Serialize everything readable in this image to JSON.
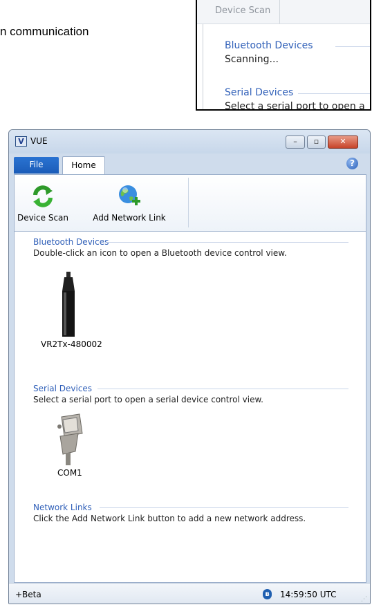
{
  "document": {
    "partial_text": "n communication"
  },
  "inset": {
    "tab_label": "Device Scan",
    "bluetooth_header": "Bluetooth Devices",
    "bluetooth_status": "Scanning...",
    "serial_header": "Serial Devices",
    "serial_desc_partial": "Select a serial port to open a"
  },
  "window": {
    "title": "VUE",
    "app_icon_letter": "V",
    "controls": {
      "minimize": "–",
      "maximize": "▫",
      "close": "✕"
    }
  },
  "ribbon": {
    "file_tab": "File",
    "home_tab": "Home",
    "help": "?",
    "buttons": [
      {
        "label": "Device Scan",
        "icon": "refresh-icon"
      },
      {
        "label": "Add Network Link",
        "icon": "globe-add-icon"
      }
    ]
  },
  "groups": {
    "bluetooth": {
      "header": "Bluetooth Devices",
      "description": "Double-click an icon to open a Bluetooth device control view.",
      "devices": [
        {
          "label": "VR2Tx-480002",
          "icon": "receiver-icon"
        }
      ]
    },
    "serial": {
      "header": "Serial Devices",
      "description": "Select a serial port to open a serial device control view.",
      "devices": [
        {
          "label": "COM1",
          "icon": "serial-port-icon"
        }
      ]
    },
    "network": {
      "header": "Network Links",
      "description": "Click the Add Network Link button to add a new network address."
    }
  },
  "status": {
    "left": "+Beta",
    "bluetooth_glyph": "ʙ",
    "time": "14:59:50 UTC"
  },
  "colors": {
    "group_header": "#2f5fb8",
    "file_tab": "#1b5cb8",
    "window_frame": "#cfdcec"
  }
}
